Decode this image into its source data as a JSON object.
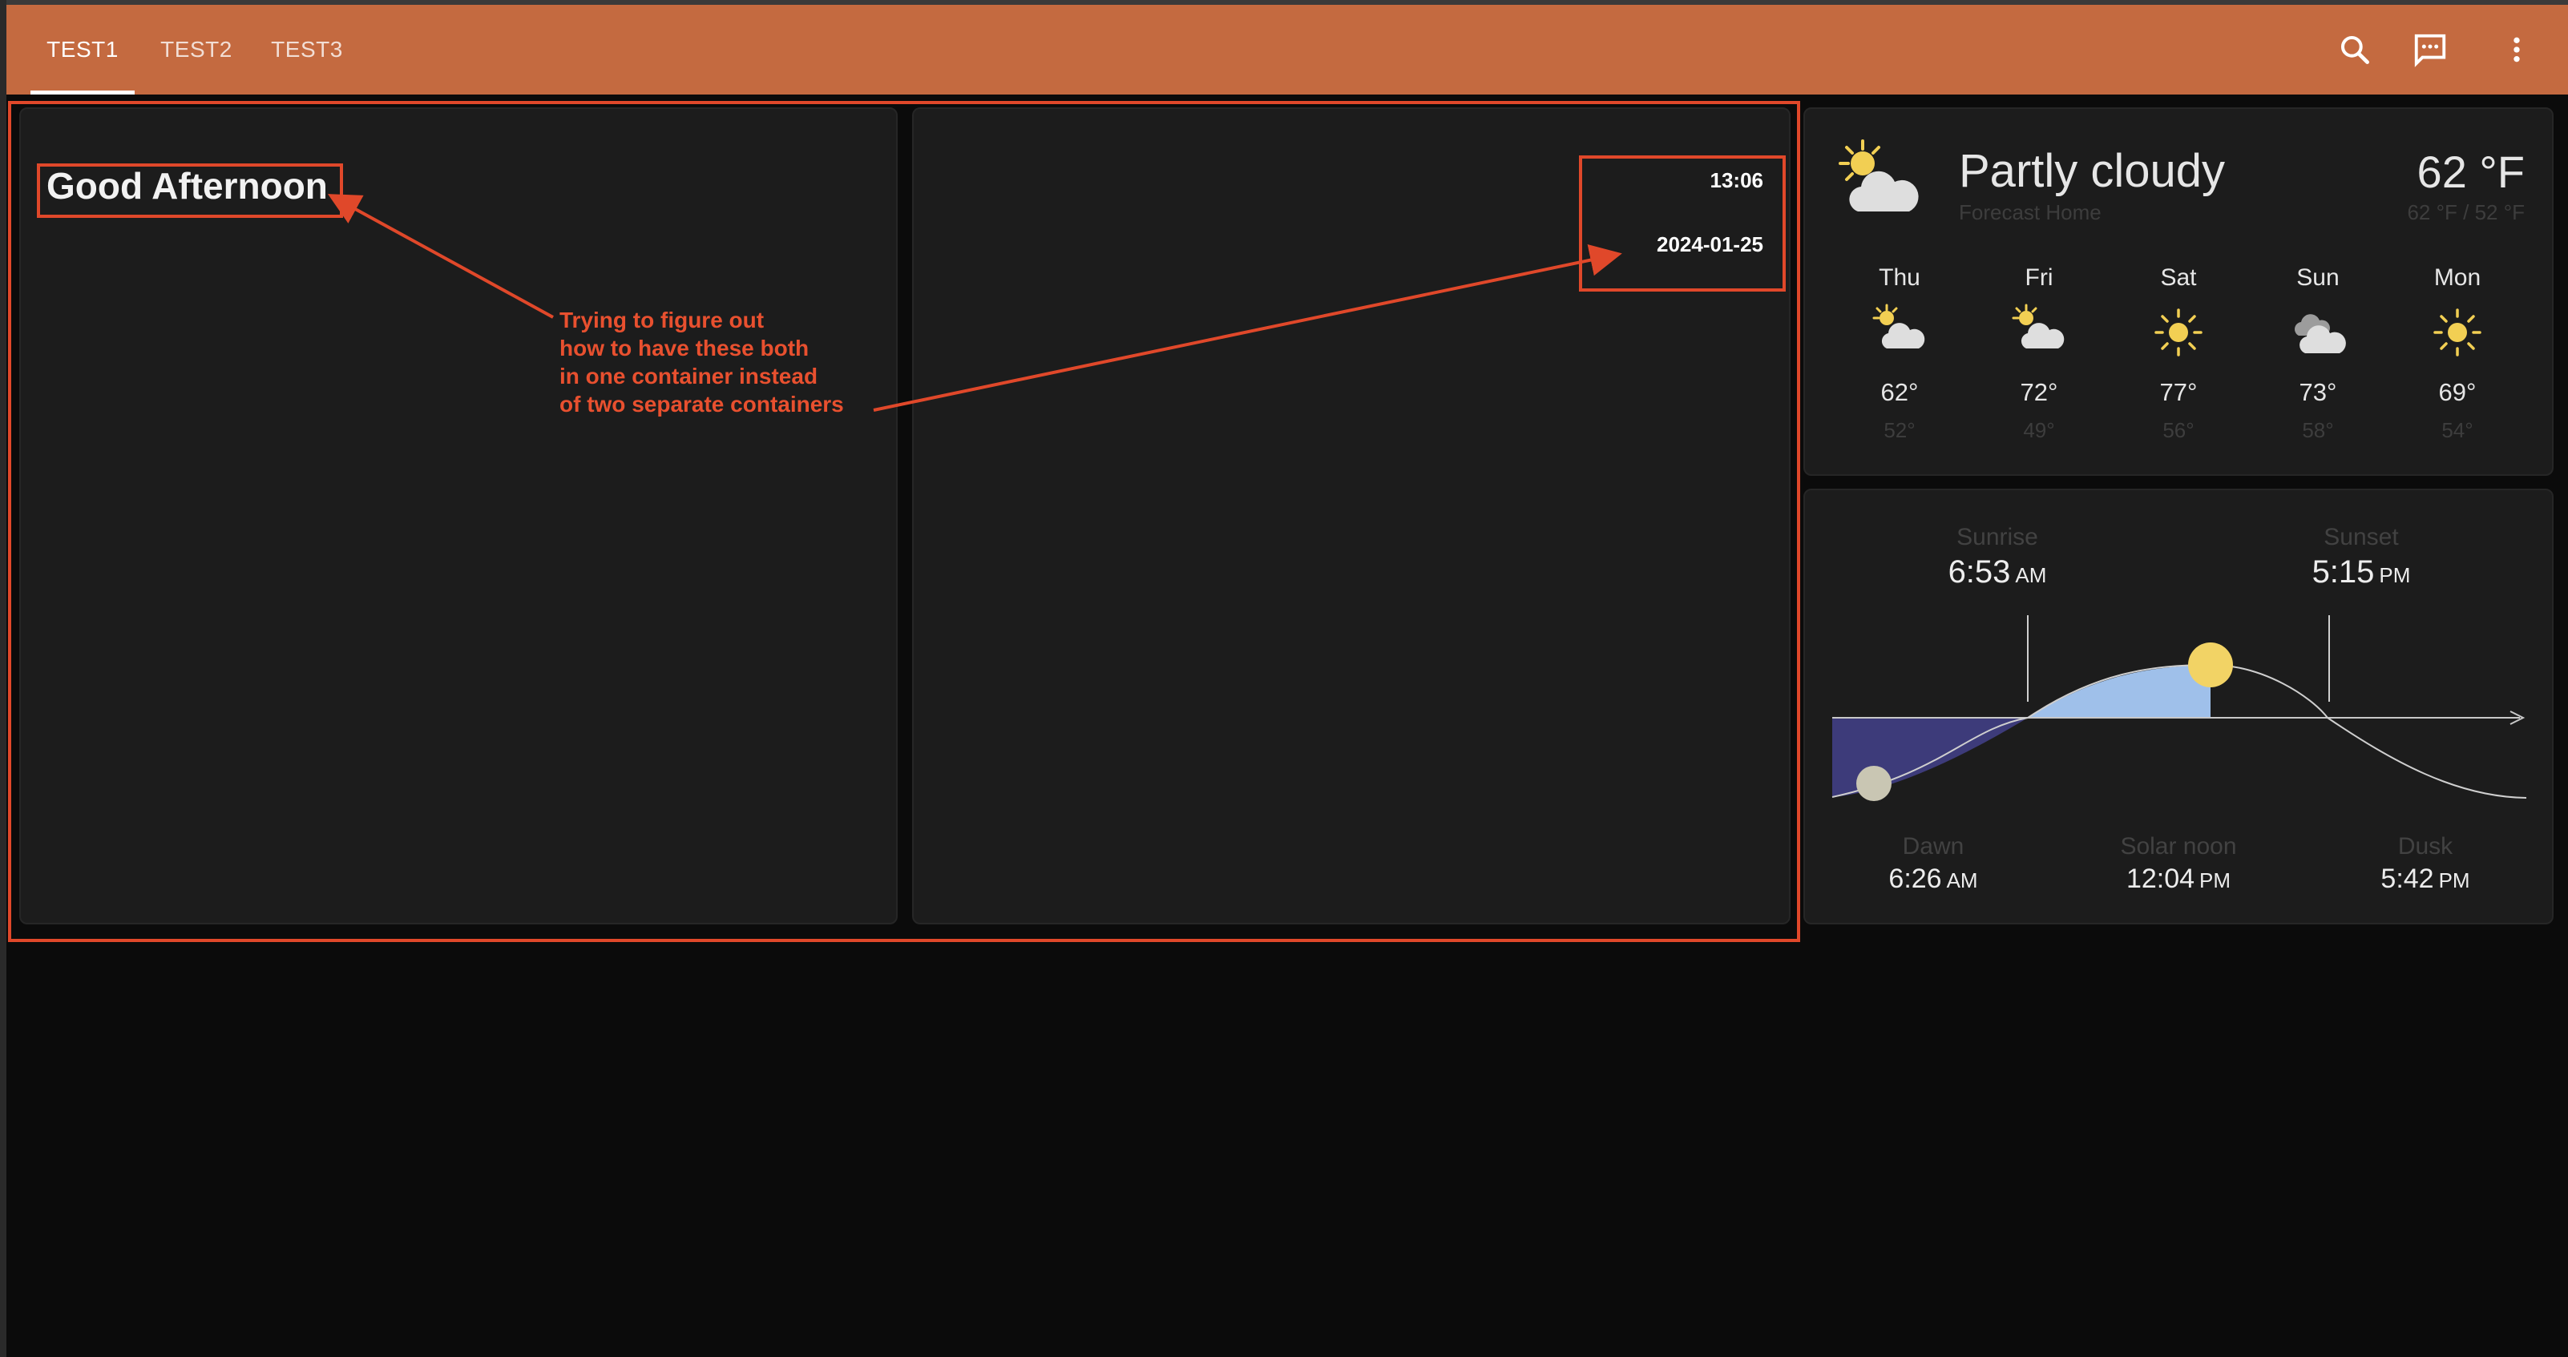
{
  "header": {
    "tabs": [
      {
        "label": "TEST1",
        "active": true
      },
      {
        "label": "TEST2",
        "active": false
      },
      {
        "label": "TEST3",
        "active": false
      }
    ],
    "icons": [
      "search-icon",
      "chat-icon",
      "more-vert-icon"
    ],
    "accent_color": "#c46a40"
  },
  "greeting": {
    "text": "Good Afternoon"
  },
  "clock": {
    "time": "13:06",
    "date": "2024-01-25"
  },
  "annotation": {
    "lines": [
      "Trying to figure out",
      "how to have these both",
      "in one container instead",
      "of two separate containers"
    ],
    "color": "#e0482a"
  },
  "weather": {
    "condition": "Partly cloudy",
    "location": "Forecast Home",
    "current_temp": "62 °F",
    "high_low": "62 °F / 52 °F",
    "forecast": [
      {
        "day": "Thu",
        "high": "62°",
        "low": "52°",
        "icon": "partly-cloudy-icon"
      },
      {
        "day": "Fri",
        "high": "72°",
        "low": "49°",
        "icon": "partly-cloudy-icon"
      },
      {
        "day": "Sat",
        "high": "77°",
        "low": "56°",
        "icon": "sunny-icon"
      },
      {
        "day": "Sun",
        "high": "73°",
        "low": "58°",
        "icon": "cloudy-icon"
      },
      {
        "day": "Mon",
        "high": "69°",
        "low": "54°",
        "icon": "sunny-icon"
      }
    ]
  },
  "sun": {
    "sunrise_label": "Sunrise",
    "sunrise_time": "6:53",
    "sunrise_ampm": "AM",
    "sunset_label": "Sunset",
    "sunset_time": "5:15",
    "sunset_ampm": "PM",
    "dawn_label": "Dawn",
    "dawn_time": "6:26",
    "dawn_ampm": "AM",
    "noon_label": "Solar noon",
    "noon_time": "12:04",
    "noon_ampm": "PM",
    "dusk_label": "Dusk",
    "dusk_time": "5:42",
    "dusk_ampm": "PM"
  }
}
